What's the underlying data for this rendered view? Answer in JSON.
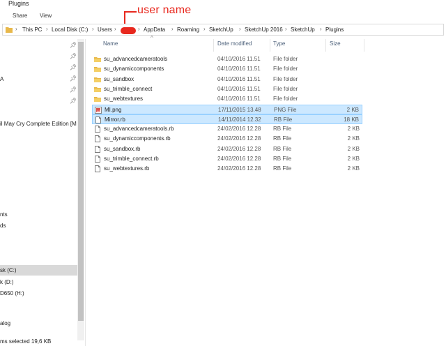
{
  "window": {
    "title": "Plugins"
  },
  "ribbon": {
    "tabs": [
      "Share",
      "View"
    ]
  },
  "annotation": {
    "label": "user name",
    "color": "#e8281e"
  },
  "address": {
    "crumbs": [
      "This PC",
      "Local Disk (C:)",
      "Users",
      "AppData",
      "Roaming",
      "SketchUp",
      "SketchUp 2016",
      "SketchUp",
      "Plugins"
    ]
  },
  "nav": {
    "items": [
      "A",
      "il May Cry Complete Edition [M",
      "nts",
      "ds",
      "sk (C:)",
      "k (D:)",
      "D650 (H:)",
      "alog"
    ],
    "selected_index": 4
  },
  "columns": {
    "name": "Name",
    "date": "Date modified",
    "type": "Type",
    "size": "Size"
  },
  "files": [
    {
      "name": "su_advancedcameratools",
      "date": "04/10/2016 11.51",
      "type": "File folder",
      "size": "",
      "icon": "folder-icon",
      "selected": false
    },
    {
      "name": "su_dynamiccomponents",
      "date": "04/10/2016 11.51",
      "type": "File folder",
      "size": "",
      "icon": "folder-icon",
      "selected": false
    },
    {
      "name": "su_sandbox",
      "date": "04/10/2016 11.51",
      "type": "File folder",
      "size": "",
      "icon": "folder-icon",
      "selected": false
    },
    {
      "name": "su_trimble_connect",
      "date": "04/10/2016 11.51",
      "type": "File folder",
      "size": "",
      "icon": "folder-icon",
      "selected": false
    },
    {
      "name": "su_webtextures",
      "date": "04/10/2016 11.51",
      "type": "File folder",
      "size": "",
      "icon": "folder-icon",
      "selected": false
    },
    {
      "name": "MI.png",
      "date": "17/11/2015 13.48",
      "type": "PNG File",
      "size": "2 KB",
      "icon": "image-file-icon",
      "selected": true
    },
    {
      "name": "Mirror.rb",
      "date": "14/11/2014 12.32",
      "type": "RB File",
      "size": "18 KB",
      "icon": "document-icon",
      "selected": true
    },
    {
      "name": "su_advancedcameratools.rb",
      "date": "24/02/2016 12.28",
      "type": "RB File",
      "size": "2 KB",
      "icon": "document-icon",
      "selected": false
    },
    {
      "name": "su_dynamiccomponents.rb",
      "date": "24/02/2016 12.28",
      "type": "RB File",
      "size": "2 KB",
      "icon": "document-icon",
      "selected": false
    },
    {
      "name": "su_sandbox.rb",
      "date": "24/02/2016 12.28",
      "type": "RB File",
      "size": "2 KB",
      "icon": "document-icon",
      "selected": false
    },
    {
      "name": "su_trimble_connect.rb",
      "date": "24/02/2016 12.28",
      "type": "RB File",
      "size": "2 KB",
      "icon": "document-icon",
      "selected": false
    },
    {
      "name": "su_webtextures.rb",
      "date": "24/02/2016 12.28",
      "type": "RB File",
      "size": "2 KB",
      "icon": "document-icon",
      "selected": false
    }
  ],
  "status": {
    "text": "ms selected  19,6 KB"
  }
}
